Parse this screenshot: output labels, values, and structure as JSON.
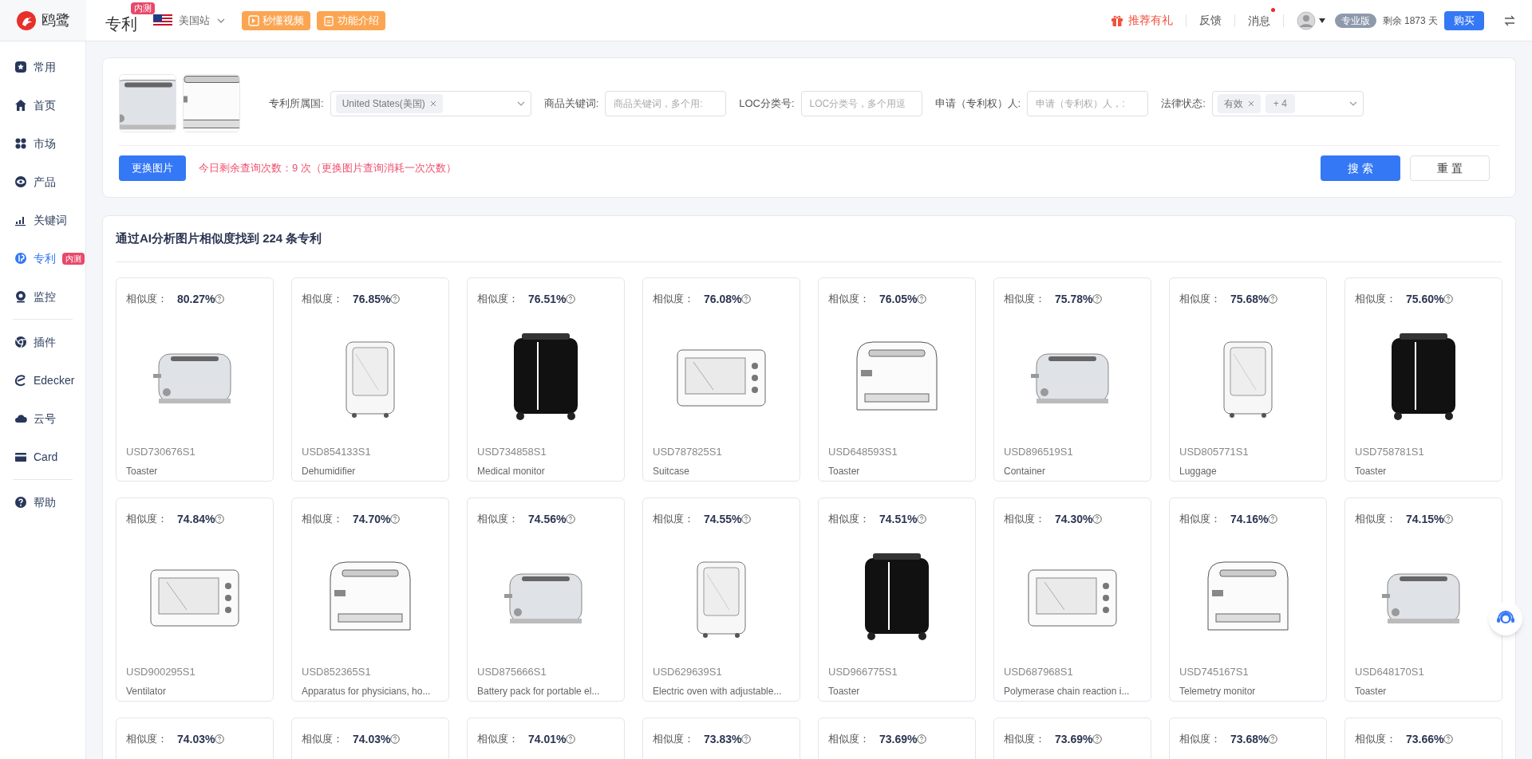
{
  "header": {
    "logo_text": "鸥鹭",
    "page_title": "专利",
    "page_badge": "内测",
    "site": "美国站",
    "buttons": [
      {
        "kind": "video",
        "label": "秒懂视频"
      },
      {
        "kind": "intro",
        "label": "功能介绍"
      }
    ],
    "referral": "推荐有礼",
    "feedback": "反馈",
    "messages": {
      "label": "消息",
      "unread": true
    },
    "plan": "专业版",
    "remaining": "剩余 1873 天",
    "buy": "购买"
  },
  "sidebar": {
    "items": [
      {
        "label": "常用",
        "selected": false
      },
      {
        "label": "首页",
        "selected": false
      },
      {
        "label": "市场",
        "selected": false
      },
      {
        "label": "产品",
        "selected": false
      },
      {
        "label": "关键词",
        "selected": false
      },
      {
        "label": "专利",
        "selected": true,
        "badge": "内测"
      },
      {
        "label": "监控",
        "selected": false
      },
      {
        "label": "插件",
        "selected": false
      },
      {
        "label": "Edecker",
        "selected": false
      },
      {
        "label": "云号",
        "selected": false
      },
      {
        "label": "Card",
        "selected": false
      },
      {
        "label": "帮助",
        "selected": false
      }
    ]
  },
  "filters": {
    "fields": [
      {
        "kind": "select",
        "label": "专利所属国:",
        "tags": [
          "United States(美国)"
        ]
      },
      {
        "kind": "input",
        "label": "商品关键词:",
        "placeholder": "商品关键词，多个用:"
      },
      {
        "kind": "input",
        "label": "LOC分类号:",
        "placeholder": "LOC分类号，多个用逗"
      },
      {
        "kind": "input",
        "label": "申请（专利权）人:",
        "placeholder": "申请（专利权）人，:"
      },
      {
        "kind": "select",
        "label": "法律状态:",
        "tags": [
          "有效"
        ],
        "more": "+ 4"
      }
    ],
    "change_image": "更换图片",
    "quota_note": "今日剩余查询次数：9 次（更换图片查询消耗一次次数）",
    "search": "搜 索",
    "reset": "重 置"
  },
  "results": {
    "title": "通过AI分析图片相似度找到 224 条专利",
    "cards": [
      {
        "label": "相似度：",
        "similarity": "80.27%",
        "number": "USD730676S1",
        "title": "Toaster"
      },
      {
        "label": "相似度：",
        "similarity": "76.85%",
        "number": "USD854133S1",
        "title": "Dehumidifier"
      },
      {
        "label": "相似度：",
        "similarity": "76.51%",
        "number": "USD734858S1",
        "title": "Medical monitor"
      },
      {
        "label": "相似度：",
        "similarity": "76.08%",
        "number": "USD787825S1",
        "title": "Suitcase"
      },
      {
        "label": "相似度：",
        "similarity": "76.05%",
        "number": "USD648593S1",
        "title": "Toaster"
      },
      {
        "label": "相似度：",
        "similarity": "75.78%",
        "number": "USD896519S1",
        "title": "Container"
      },
      {
        "label": "相似度：",
        "similarity": "75.68%",
        "number": "USD805771S1",
        "title": "Luggage"
      },
      {
        "label": "相似度：",
        "similarity": "75.60%",
        "number": "USD758781S1",
        "title": "Toaster"
      },
      {
        "label": "相似度：",
        "similarity": "74.84%",
        "number": "USD900295S1",
        "title": "Ventilator"
      },
      {
        "label": "相似度：",
        "similarity": "74.70%",
        "number": "USD852365S1",
        "title": "Apparatus for physicians, ho..."
      },
      {
        "label": "相似度：",
        "similarity": "74.56%",
        "number": "USD875666S1",
        "title": "Battery pack for portable el..."
      },
      {
        "label": "相似度：",
        "similarity": "74.55%",
        "number": "USD629639S1",
        "title": "Electric oven with adjustable..."
      },
      {
        "label": "相似度：",
        "similarity": "74.51%",
        "number": "USD966775S1",
        "title": "Toaster"
      },
      {
        "label": "相似度：",
        "similarity": "74.30%",
        "number": "USD687968S1",
        "title": "Polymerase chain reaction i..."
      },
      {
        "label": "相似度：",
        "similarity": "74.16%",
        "number": "USD745167S1",
        "title": "Telemetry monitor"
      },
      {
        "label": "相似度：",
        "similarity": "74.15%",
        "number": "USD648170S1",
        "title": "Toaster"
      },
      {
        "label": "相似度：",
        "similarity": "74.03%"
      },
      {
        "label": "相似度：",
        "similarity": "74.03%"
      },
      {
        "label": "相似度：",
        "similarity": "74.01%"
      },
      {
        "label": "相似度：",
        "similarity": "73.83%"
      },
      {
        "label": "相似度：",
        "similarity": "73.69%"
      },
      {
        "label": "相似度：",
        "similarity": "73.69%"
      },
      {
        "label": "相似度：",
        "similarity": "73.68%"
      },
      {
        "label": "相似度：",
        "similarity": "73.66%"
      }
    ]
  }
}
